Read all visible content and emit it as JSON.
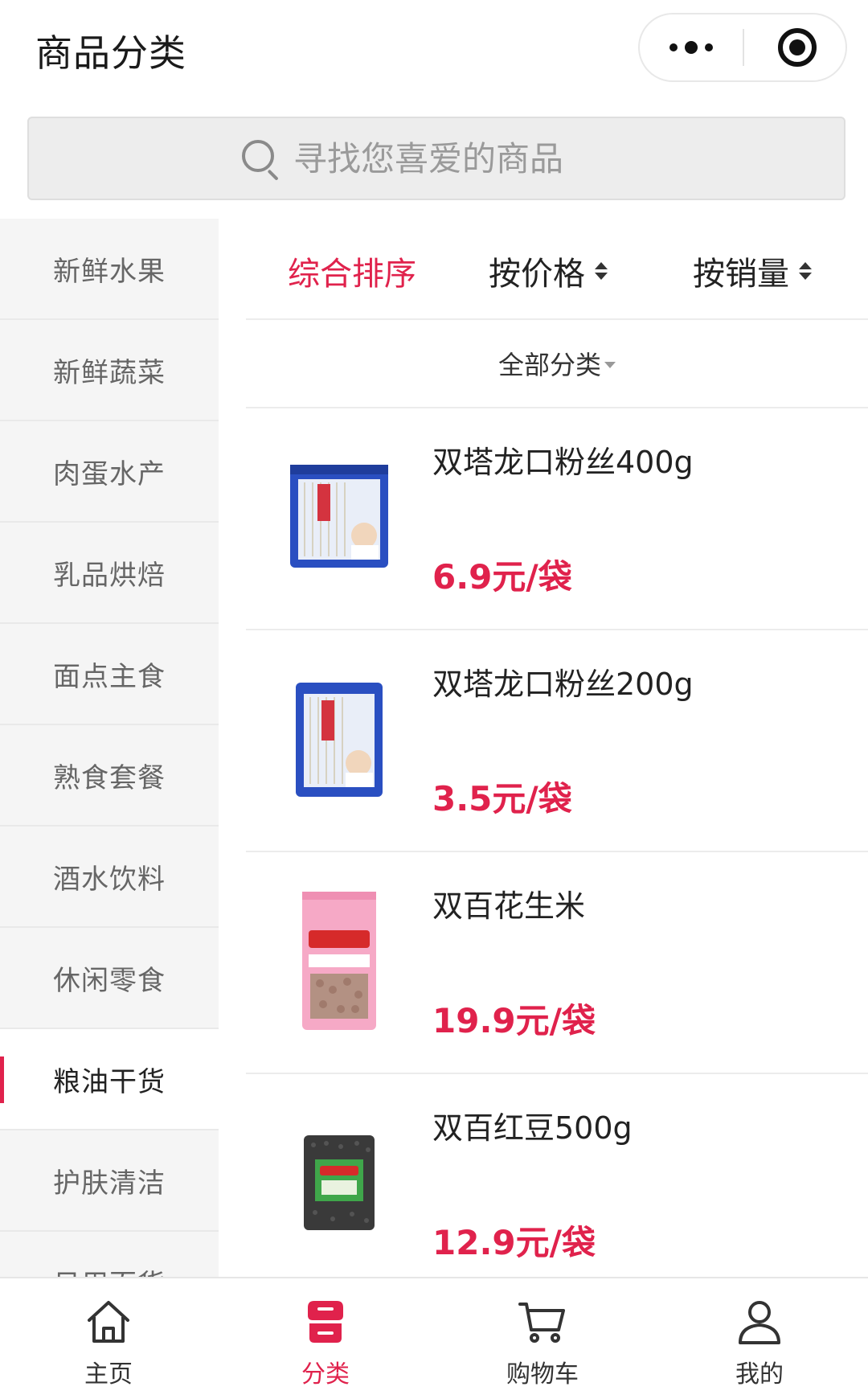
{
  "header": {
    "title": "商品分类"
  },
  "search": {
    "placeholder": "寻找您喜爱的商品"
  },
  "sidebar": {
    "items": [
      {
        "label": "新鲜水果",
        "active": false
      },
      {
        "label": "新鲜蔬菜",
        "active": false
      },
      {
        "label": "肉蛋水产",
        "active": false
      },
      {
        "label": "乳品烘焙",
        "active": false
      },
      {
        "label": "面点主食",
        "active": false
      },
      {
        "label": "熟食套餐",
        "active": false
      },
      {
        "label": "酒水饮料",
        "active": false
      },
      {
        "label": "休闲零食",
        "active": false
      },
      {
        "label": "粮油干货",
        "active": true
      },
      {
        "label": "护肤清洁",
        "active": false
      },
      {
        "label": "日用百货",
        "active": false
      }
    ]
  },
  "sort": {
    "comprehensive": "综合排序",
    "by_price": "按价格",
    "by_sales": "按销量"
  },
  "category_filter": {
    "label": "全部分类"
  },
  "products": [
    {
      "name": "双塔龙口粉丝400g",
      "price": "6.9元/袋"
    },
    {
      "name": "双塔龙口粉丝200g",
      "price": "3.5元/袋"
    },
    {
      "name": "双百花生米",
      "price": "19.9元/袋"
    },
    {
      "name": "双百红豆500g",
      "price": "12.9元/袋"
    }
  ],
  "tabbar": {
    "items": [
      {
        "label": "主页",
        "icon": "home-icon",
        "active": false
      },
      {
        "label": "分类",
        "icon": "category-icon",
        "active": true
      },
      {
        "label": "购物车",
        "icon": "cart-icon",
        "active": false
      },
      {
        "label": "我的",
        "icon": "user-icon",
        "active": false
      }
    ]
  },
  "colors": {
    "accent": "#e0224c",
    "sidebar_bg": "#f5f5f5",
    "search_bg": "#ededed"
  }
}
